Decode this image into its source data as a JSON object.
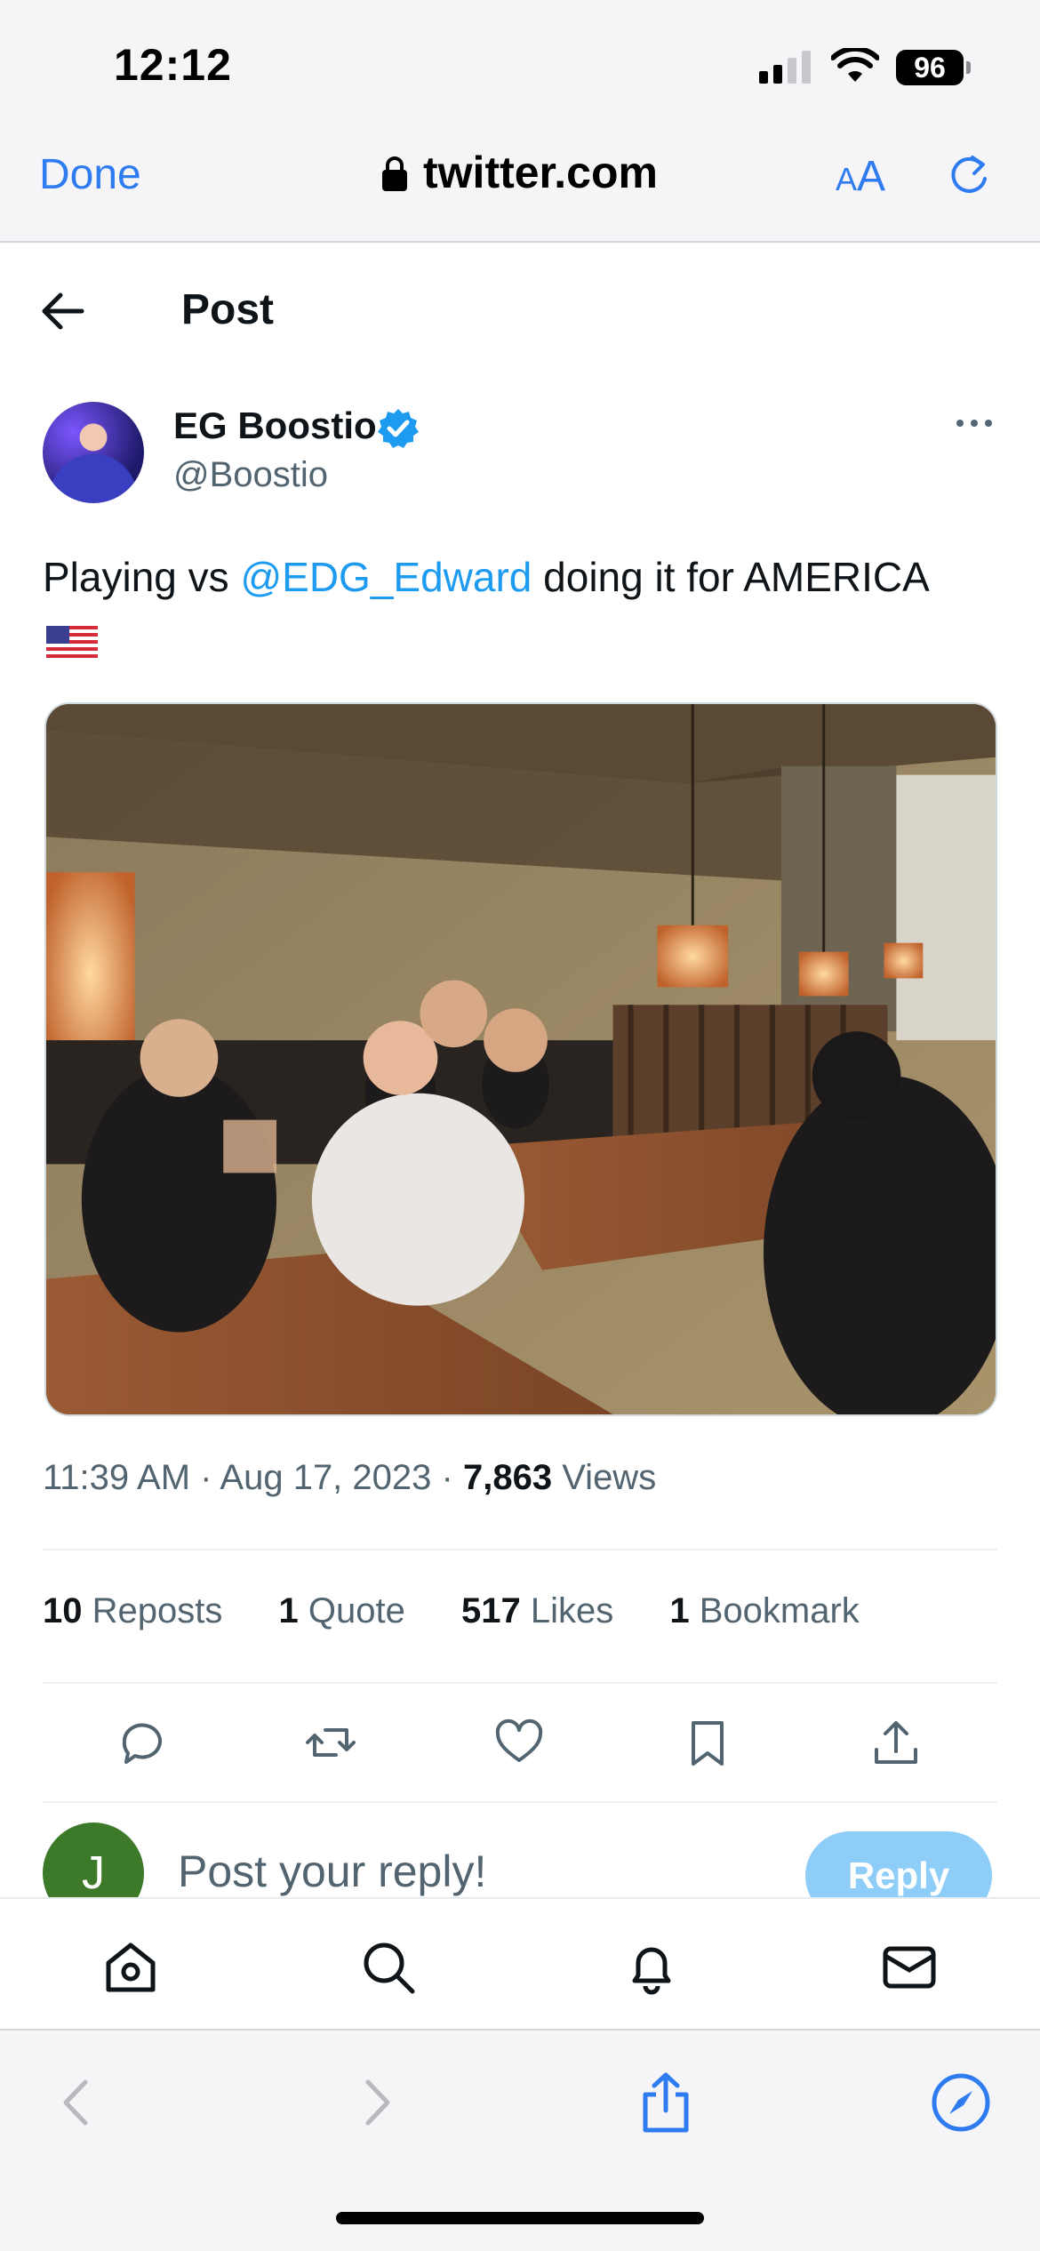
{
  "status_bar": {
    "time": "12:12",
    "battery": "96"
  },
  "browser": {
    "done_label": "Done",
    "url": "twitter.com",
    "text_size_label_small": "A",
    "text_size_label_large": "A"
  },
  "header": {
    "title": "Post"
  },
  "author": {
    "name": "EG Boostio",
    "handle": "@Boostio",
    "verified": true
  },
  "tweet": {
    "text_before": "Playing vs ",
    "mention": "@EDG_Edward",
    "text_after": " doing it for AMERICA",
    "emoji": "🇺🇸"
  },
  "meta": {
    "time": "11:39 AM",
    "date": "Aug 17, 2023",
    "views_count": "7,863",
    "views_label": "Views",
    "separator": "·"
  },
  "stats": [
    {
      "count": "10",
      "label": "Reposts"
    },
    {
      "count": "1",
      "label": "Quote"
    },
    {
      "count": "517",
      "label": "Likes"
    },
    {
      "count": "1",
      "label": "Bookmark"
    }
  ],
  "reply": {
    "avatar_letter": "J",
    "placeholder": "Post your reply!",
    "button_label": "Reply"
  },
  "colors": {
    "link": "#1d9bf0",
    "safari_blue": "#2f7bf0",
    "reply_button": "#8ecdf8",
    "secondary_text": "#536471"
  },
  "icons": {
    "actions": [
      "reply-icon",
      "repost-icon",
      "like-icon",
      "bookmark-icon",
      "share-icon"
    ],
    "tabs": [
      "home-icon",
      "search-icon",
      "notifications-icon",
      "messages-icon"
    ],
    "safari": [
      "back-arrow-icon",
      "forward-arrow-icon",
      "share-icon",
      "compass-icon"
    ]
  }
}
